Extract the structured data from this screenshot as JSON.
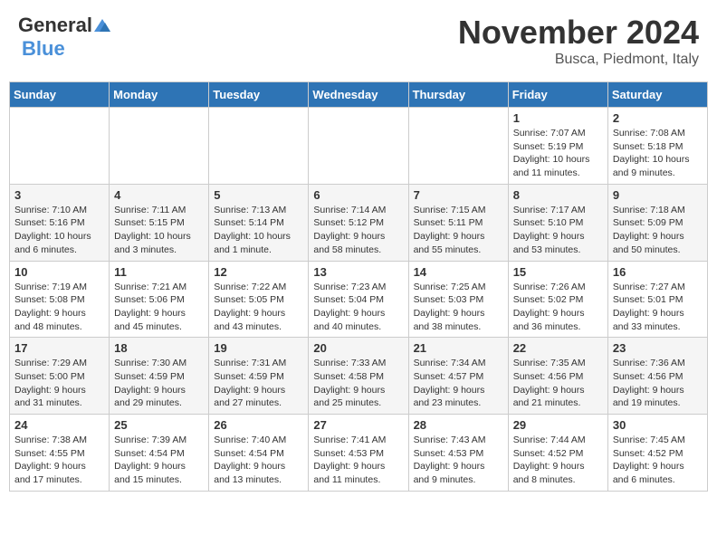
{
  "header": {
    "logo_general": "General",
    "logo_blue": "Blue",
    "month_title": "November 2024",
    "location": "Busca, Piedmont, Italy"
  },
  "days_of_week": [
    "Sunday",
    "Monday",
    "Tuesday",
    "Wednesday",
    "Thursday",
    "Friday",
    "Saturday"
  ],
  "weeks": [
    [
      {
        "day": "",
        "info": ""
      },
      {
        "day": "",
        "info": ""
      },
      {
        "day": "",
        "info": ""
      },
      {
        "day": "",
        "info": ""
      },
      {
        "day": "",
        "info": ""
      },
      {
        "day": "1",
        "info": "Sunrise: 7:07 AM\nSunset: 5:19 PM\nDaylight: 10 hours and 11 minutes."
      },
      {
        "day": "2",
        "info": "Sunrise: 7:08 AM\nSunset: 5:18 PM\nDaylight: 10 hours and 9 minutes."
      }
    ],
    [
      {
        "day": "3",
        "info": "Sunrise: 7:10 AM\nSunset: 5:16 PM\nDaylight: 10 hours and 6 minutes."
      },
      {
        "day": "4",
        "info": "Sunrise: 7:11 AM\nSunset: 5:15 PM\nDaylight: 10 hours and 3 minutes."
      },
      {
        "day": "5",
        "info": "Sunrise: 7:13 AM\nSunset: 5:14 PM\nDaylight: 10 hours and 1 minute."
      },
      {
        "day": "6",
        "info": "Sunrise: 7:14 AM\nSunset: 5:12 PM\nDaylight: 9 hours and 58 minutes."
      },
      {
        "day": "7",
        "info": "Sunrise: 7:15 AM\nSunset: 5:11 PM\nDaylight: 9 hours and 55 minutes."
      },
      {
        "day": "8",
        "info": "Sunrise: 7:17 AM\nSunset: 5:10 PM\nDaylight: 9 hours and 53 minutes."
      },
      {
        "day": "9",
        "info": "Sunrise: 7:18 AM\nSunset: 5:09 PM\nDaylight: 9 hours and 50 minutes."
      }
    ],
    [
      {
        "day": "10",
        "info": "Sunrise: 7:19 AM\nSunset: 5:08 PM\nDaylight: 9 hours and 48 minutes."
      },
      {
        "day": "11",
        "info": "Sunrise: 7:21 AM\nSunset: 5:06 PM\nDaylight: 9 hours and 45 minutes."
      },
      {
        "day": "12",
        "info": "Sunrise: 7:22 AM\nSunset: 5:05 PM\nDaylight: 9 hours and 43 minutes."
      },
      {
        "day": "13",
        "info": "Sunrise: 7:23 AM\nSunset: 5:04 PM\nDaylight: 9 hours and 40 minutes."
      },
      {
        "day": "14",
        "info": "Sunrise: 7:25 AM\nSunset: 5:03 PM\nDaylight: 9 hours and 38 minutes."
      },
      {
        "day": "15",
        "info": "Sunrise: 7:26 AM\nSunset: 5:02 PM\nDaylight: 9 hours and 36 minutes."
      },
      {
        "day": "16",
        "info": "Sunrise: 7:27 AM\nSunset: 5:01 PM\nDaylight: 9 hours and 33 minutes."
      }
    ],
    [
      {
        "day": "17",
        "info": "Sunrise: 7:29 AM\nSunset: 5:00 PM\nDaylight: 9 hours and 31 minutes."
      },
      {
        "day": "18",
        "info": "Sunrise: 7:30 AM\nSunset: 4:59 PM\nDaylight: 9 hours and 29 minutes."
      },
      {
        "day": "19",
        "info": "Sunrise: 7:31 AM\nSunset: 4:59 PM\nDaylight: 9 hours and 27 minutes."
      },
      {
        "day": "20",
        "info": "Sunrise: 7:33 AM\nSunset: 4:58 PM\nDaylight: 9 hours and 25 minutes."
      },
      {
        "day": "21",
        "info": "Sunrise: 7:34 AM\nSunset: 4:57 PM\nDaylight: 9 hours and 23 minutes."
      },
      {
        "day": "22",
        "info": "Sunrise: 7:35 AM\nSunset: 4:56 PM\nDaylight: 9 hours and 21 minutes."
      },
      {
        "day": "23",
        "info": "Sunrise: 7:36 AM\nSunset: 4:56 PM\nDaylight: 9 hours and 19 minutes."
      }
    ],
    [
      {
        "day": "24",
        "info": "Sunrise: 7:38 AM\nSunset: 4:55 PM\nDaylight: 9 hours and 17 minutes."
      },
      {
        "day": "25",
        "info": "Sunrise: 7:39 AM\nSunset: 4:54 PM\nDaylight: 9 hours and 15 minutes."
      },
      {
        "day": "26",
        "info": "Sunrise: 7:40 AM\nSunset: 4:54 PM\nDaylight: 9 hours and 13 minutes."
      },
      {
        "day": "27",
        "info": "Sunrise: 7:41 AM\nSunset: 4:53 PM\nDaylight: 9 hours and 11 minutes."
      },
      {
        "day": "28",
        "info": "Sunrise: 7:43 AM\nSunset: 4:53 PM\nDaylight: 9 hours and 9 minutes."
      },
      {
        "day": "29",
        "info": "Sunrise: 7:44 AM\nSunset: 4:52 PM\nDaylight: 9 hours and 8 minutes."
      },
      {
        "day": "30",
        "info": "Sunrise: 7:45 AM\nSunset: 4:52 PM\nDaylight: 9 hours and 6 minutes."
      }
    ]
  ]
}
